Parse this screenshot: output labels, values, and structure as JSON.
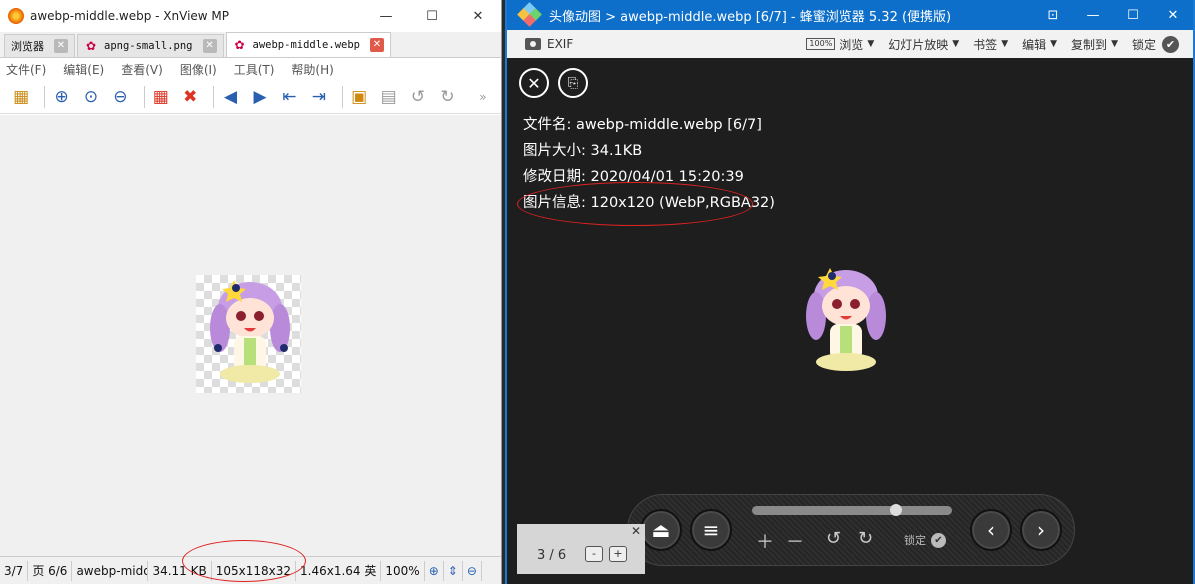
{
  "xnview": {
    "title": "awebp-middle.webp - XnView MP",
    "tabs": [
      {
        "label": "浏览器",
        "close": "✕"
      },
      {
        "label": "apng-small.png",
        "close": "✕"
      },
      {
        "label": "awebp-middle.webp",
        "close": "✕"
      }
    ],
    "menu": [
      "文件(F)",
      "编辑(E)",
      "查看(V)",
      "图像(I)",
      "工具(T)",
      "帮助(H)"
    ],
    "more": "»",
    "status": {
      "page": "3/7",
      "frame": "页 6/6",
      "filename": "awebp-middc",
      "size": "34.11 KB",
      "dimensions": "105x118x32",
      "print_size": "1.46x1.64 英",
      "zoom": "100%"
    }
  },
  "honeyview": {
    "title": "头像动图 > awebp-middle.webp [6/7] - 蜂蜜浏览器 5.32 (便携版)",
    "toolbar": {
      "exif": "EXIF",
      "pct": "100%",
      "browse": "浏览",
      "slideshow": "幻灯片放映",
      "bookmark": "书签",
      "edit": "编辑",
      "copyto": "复制到",
      "lock": "锁定"
    },
    "info": {
      "filename": "文件名: awebp-middle.webp [6/7]",
      "filesize": "图片大小: 34.1KB",
      "modified": "修改日期: 2020/04/01 15:20:39",
      "imageinfo": "图片信息: 120x120 (WebP,RGBA32)"
    },
    "panel": {
      "lock": "锁定",
      "slider_value": 0.72
    },
    "pager": {
      "text": "3 / 6",
      "minus": "-",
      "plus": "+",
      "close": "✕"
    }
  }
}
